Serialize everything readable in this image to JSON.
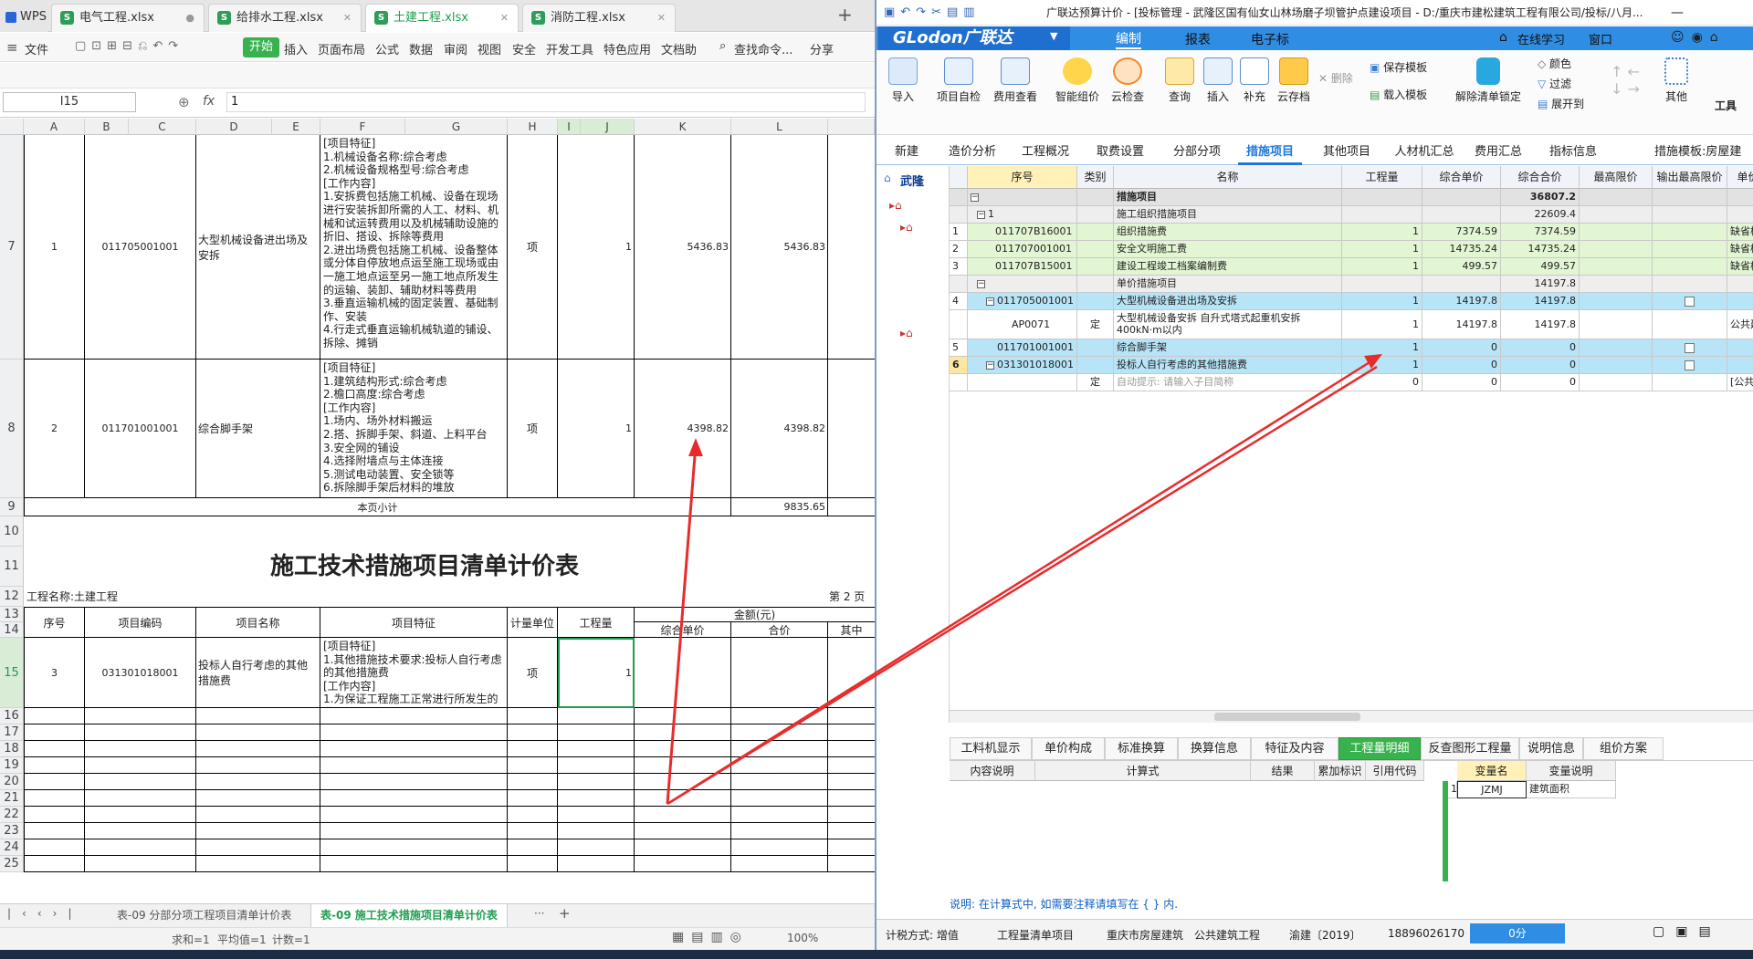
{
  "wps": {
    "tabs": [
      {
        "label": "WPS"
      },
      {
        "label": "电气工程.xlsx"
      },
      {
        "label": "给排水工程.xlsx"
      },
      {
        "label": "土建工程.xlsx"
      },
      {
        "label": "消防工程.xlsx"
      }
    ],
    "ribbon": {
      "file": "文件",
      "start": "开始",
      "menus": [
        "插入",
        "页面布局",
        "公式",
        "数据",
        "审阅",
        "视图",
        "安全",
        "开发工具",
        "特色应用",
        "文档助"
      ],
      "search": "查找命令...",
      "share": "分享"
    },
    "formula": {
      "namebox": "I15",
      "fx": "fx",
      "value": "1"
    },
    "col_headers": [
      "A",
      "B",
      "C",
      "D",
      "E",
      "F",
      "G",
      "H",
      "I",
      "J",
      "K",
      "L"
    ],
    "rows": {
      "r7": {
        "num": "7",
        "seq": "1",
        "code": "011705001001",
        "name": "大型机械设备进出场及安拆",
        "features": "[项目特征]\n1.机械设备名称:综合考虑\n2.机械设备规格型号:综合考虑\n[工作内容]\n1.安拆费包括施工机械、设备在现场进行安装拆卸所需的人工、材料、机械和试运转费用以及机械辅助设施的折旧、搭设、拆除等费用\n2.进出场费包括施工机械、设备整体或分体自停放地点运至施工现场或由一施工地点运至另一施工地点所发生的运输、装卸、辅助材料等费用\n3.垂直运输机械的固定装置、基础制作、安装\n4.行走式垂直运输机械轨道的铺设、拆除、摊销",
        "unit": "项",
        "qty": "1",
        "price": "5436.83",
        "total": "5436.83"
      },
      "r8": {
        "num": "8",
        "seq": "2",
        "code": "011701001001",
        "name": "综合脚手架",
        "features": "[项目特征]\n1.建筑结构形式:综合考虑\n2.檐口高度:综合考虑\n[工作内容]\n1.场内、场外材料搬运\n2.搭、拆脚手架、斜道、上料平台\n3.安全网的铺设\n4.选择附墙点与主体连接\n5.测试电动装置、安全锁等\n6.拆除脚手架后材料的堆放",
        "unit": "项",
        "qty": "1",
        "price": "4398.82",
        "total": "4398.82"
      },
      "r9": {
        "num": "9",
        "label": "本页小计",
        "total": "9835.65"
      },
      "r10": {
        "num": "10"
      },
      "r11": {
        "num": "11",
        "title": "施工技术措施项目清单计价表"
      },
      "r12": {
        "num": "12",
        "project": "工程名称:土建工程",
        "page": "第  2  页"
      },
      "r13": {
        "num": "13",
        "h_seq": "序号",
        "h_code": "项目编码",
        "h_name": "项目名称",
        "h_feat": "项目特征",
        "h_unit": "计量单位",
        "h_qty": "工程量",
        "h_amount": "金额(元)"
      },
      "r14": {
        "num": "14",
        "h_price": "综合单价",
        "h_total": "合价",
        "h_other": "其中"
      },
      "r15": {
        "num": "15",
        "seq": "3",
        "code": "031301018001",
        "name": "投标人自行考虑的其他措施费",
        "features": "[项目特征]\n1.其他措施技术要求:投标人自行考虑的其他措施费\n[工作内容]\n1.为保证工程施工正常进行所发生的费用",
        "unit": "项",
        "qty": "1"
      },
      "empty_rows": [
        "16",
        "17",
        "18",
        "19",
        "20",
        "21",
        "22",
        "23",
        "24",
        "25"
      ]
    },
    "sheet_tabs": [
      "表-09 分部分项工程项目清单计价表",
      "表-09 施工技术措施项目清单计价表"
    ],
    "status": {
      "sum": "求和=1",
      "avg": "平均值=1",
      "count": "计数=1",
      "zoom": "100%"
    }
  },
  "gld": {
    "title": "广联达预算计价 - [投标管理 - 武隆区国有仙女山林场磨子坝管护点建设项目 - D:/重庆市建松建筑工程有限公司/投标/八月...",
    "brand": {
      "logo": "GLodon广联达",
      "menus": [
        "编制",
        "报表",
        "电子标"
      ],
      "learn": "在线学习",
      "window": "窗口"
    },
    "toolbar": [
      "导入",
      "项目自检",
      "费用查看",
      "智能组价",
      "云检查",
      "查询",
      "插入",
      "补充",
      "云存档",
      "删除",
      "保存模板",
      "载入模板",
      "解除清单锁定",
      "颜色",
      "过滤",
      "展开到",
      "其他",
      "工具"
    ],
    "tabs": {
      "new": "新建",
      "items": [
        "造价分析",
        "工程概况",
        "取费设置",
        "分部分项",
        "措施项目",
        "其他项目",
        "人材机汇总",
        "费用汇总",
        "指标信息"
      ],
      "template": "措施模板:房屋建"
    },
    "tree": {
      "root": "武隆"
    },
    "grid": {
      "headers": [
        "序号",
        "类别",
        "名称",
        "工程量",
        "综合单价",
        "综合合价",
        "最高限价",
        "输出最高限价",
        "单价构成"
      ],
      "rows": [
        {
          "idx": "",
          "seq": "",
          "type": "",
          "name": "措施项目",
          "qty": "",
          "price": "",
          "total": "36807.2",
          "tpl": ""
        },
        {
          "idx": "",
          "seq": "1",
          "type": "",
          "name": "施工组织措施项目",
          "qty": "",
          "price": "",
          "total": "22609.4",
          "tpl": ""
        },
        {
          "idx": "1",
          "seq": "011707B16001",
          "type": "",
          "name": "组织措施费",
          "qty": "1",
          "price": "7374.59",
          "total": "7374.59",
          "tpl": "缺省模板"
        },
        {
          "idx": "2",
          "seq": "011707001001",
          "type": "",
          "name": "安全文明施工费",
          "qty": "1",
          "price": "14735.24",
          "total": "14735.24",
          "tpl": "缺省模板"
        },
        {
          "idx": "3",
          "seq": "011707B15001",
          "type": "",
          "name": "建设工程竣工档案编制费",
          "qty": "1",
          "price": "499.57",
          "total": "499.57",
          "tpl": "缺省模板"
        },
        {
          "idx": "",
          "seq": "",
          "type": "",
          "name": "单价措施项目",
          "qty": "",
          "price": "",
          "total": "14197.8",
          "tpl": ""
        },
        {
          "idx": "4",
          "seq": "011705001001",
          "type": "",
          "name": "大型机械设备进出场及安拆",
          "qty": "1",
          "price": "14197.8",
          "total": "14197.8",
          "tpl": ""
        },
        {
          "idx": "",
          "seq": "AP0071",
          "type": "定",
          "name": "大型机械设备安拆 自升式塔式起重机安拆 400kN·m以内",
          "qty": "1",
          "price": "14197.8",
          "total": "14197.8",
          "tpl": "公共建筑工"
        },
        {
          "idx": "5",
          "seq": "011701001001",
          "type": "",
          "name": "综合脚手架",
          "qty": "1",
          "price": "0",
          "total": "0",
          "tpl": ""
        },
        {
          "idx": "6",
          "seq": "031301018001",
          "type": "",
          "name": "投标人自行考虑的其他措施费",
          "qty": "1",
          "price": "0",
          "total": "0",
          "tpl": ""
        },
        {
          "idx": "",
          "seq": "",
          "type": "定",
          "name": "自动提示: 请输入子目简称",
          "qty": "0",
          "price": "0",
          "total": "0",
          "tpl": "[公共建筑"
        }
      ]
    },
    "bottom_tabs": [
      "工料机显示",
      "单价构成",
      "标准换算",
      "换算信息",
      "特征及内容",
      "工程量明细",
      "反查图形工程量",
      "说明信息",
      "组价方案"
    ],
    "bottom_grid": {
      "headers": [
        "内容说明",
        "计算式",
        "结果",
        "累加标识",
        "引用代码"
      ],
      "var_headers": [
        "变量名",
        "变量说明"
      ],
      "var_row": {
        "idx": "1",
        "name": "JZMJ",
        "desc": "建筑面积"
      }
    },
    "hint": "说明: 在计算式中, 如需要注释请填写在 { } 内.",
    "status": [
      "计税方式: 增值",
      "工程量清单项目",
      "重庆市房屋建筑",
      "公共建筑工程",
      "渝建〔2019〕",
      "18896026170",
      "0分"
    ]
  },
  "colors": {
    "accent_green": "#37b24d",
    "gld_blue": "#2f8de4",
    "arrow_red": "#e82c2c"
  }
}
